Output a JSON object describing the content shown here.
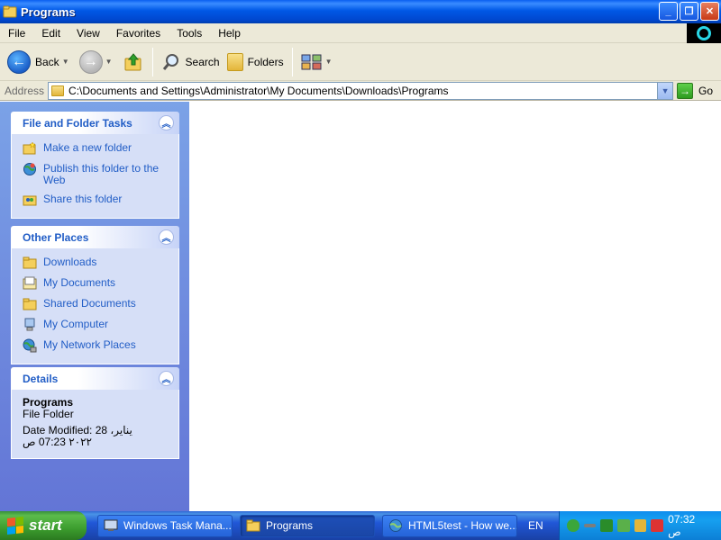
{
  "window": {
    "title": "Programs",
    "buttons": {
      "minimize": "_",
      "restore": "❐",
      "close": "✕"
    }
  },
  "menu": [
    "File",
    "Edit",
    "View",
    "Favorites",
    "Tools",
    "Help"
  ],
  "toolbar": {
    "back_label": "Back",
    "search_label": "Search",
    "folders_label": "Folders"
  },
  "address": {
    "label": "Address",
    "path": "C:\\Documents and Settings\\Administrator\\My Documents\\Downloads\\Programs",
    "go_label": "Go"
  },
  "panels": {
    "tasks": {
      "title": "File and Folder Tasks",
      "items": [
        {
          "label": "Make a new folder",
          "icon": "new-folder-icon"
        },
        {
          "label": "Publish this folder to the Web",
          "icon": "publish-web-icon"
        },
        {
          "label": "Share this folder",
          "icon": "share-folder-icon"
        }
      ]
    },
    "places": {
      "title": "Other Places",
      "items": [
        {
          "label": "Downloads",
          "icon": "folder-icon"
        },
        {
          "label": "My Documents",
          "icon": "my-documents-icon"
        },
        {
          "label": "Shared Documents",
          "icon": "folder-icon"
        },
        {
          "label": "My Computer",
          "icon": "my-computer-icon"
        },
        {
          "label": "My Network Places",
          "icon": "network-places-icon"
        }
      ]
    },
    "details": {
      "title": "Details",
      "name": "Programs",
      "type": "File Folder",
      "modified": "Date Modified: 28 يناير، ٢٠٢٢ 07:23 ص"
    }
  },
  "taskbar": {
    "start_label": "start",
    "tasks": [
      {
        "label": "Windows Task Mana...",
        "active": false
      },
      {
        "label": "Programs",
        "active": true
      },
      {
        "label": "HTML5test - How we...",
        "active": false
      }
    ],
    "language": "EN",
    "clock": "07:32 ص"
  },
  "colors": {
    "titlebar": "#0058e6",
    "pane_link": "#215dc6",
    "pane_bg": "#6f8fdf",
    "taskbar": "#245edb",
    "start": "#3c9d2e"
  }
}
